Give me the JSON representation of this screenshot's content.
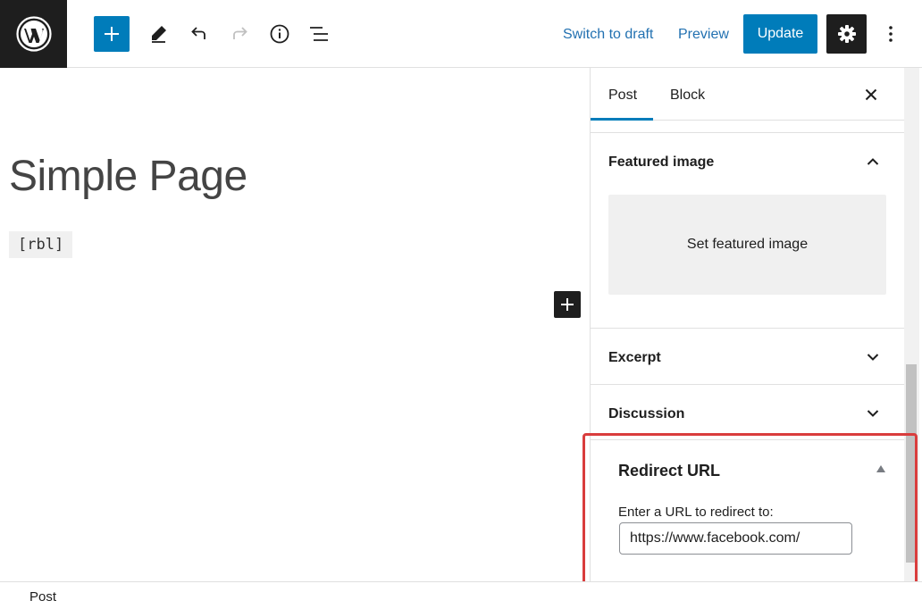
{
  "toolbar": {
    "switch_to_draft": "Switch to draft",
    "preview": "Preview",
    "update": "Update",
    "icons": [
      "wordpress-logo",
      "plus-icon",
      "pencil-icon",
      "undo-icon",
      "redo-icon",
      "info-icon",
      "list-view-icon",
      "gear-icon",
      "more-vertical-icon"
    ]
  },
  "editor": {
    "title": "Simple Page",
    "shortcode": "[rbl]"
  },
  "sidebar": {
    "tabs": [
      {
        "label": "Post",
        "active": true
      },
      {
        "label": "Block",
        "active": false
      }
    ],
    "panels": {
      "featured_image": {
        "title": "Featured image",
        "button": "Set featured image",
        "expanded": true
      },
      "excerpt": {
        "title": "Excerpt",
        "expanded": false
      },
      "discussion": {
        "title": "Discussion",
        "expanded": false
      },
      "redirect": {
        "title": "Redirect URL",
        "label": "Enter a URL to redirect to:",
        "value": "https://www.facebook.com/",
        "expanded": true
      }
    }
  },
  "footer": {
    "breadcrumb": "Post"
  },
  "colors": {
    "accent": "#007cba",
    "dark": "#1e1e1e",
    "highlight": "#d93d3d",
    "link": "#2271b1"
  }
}
